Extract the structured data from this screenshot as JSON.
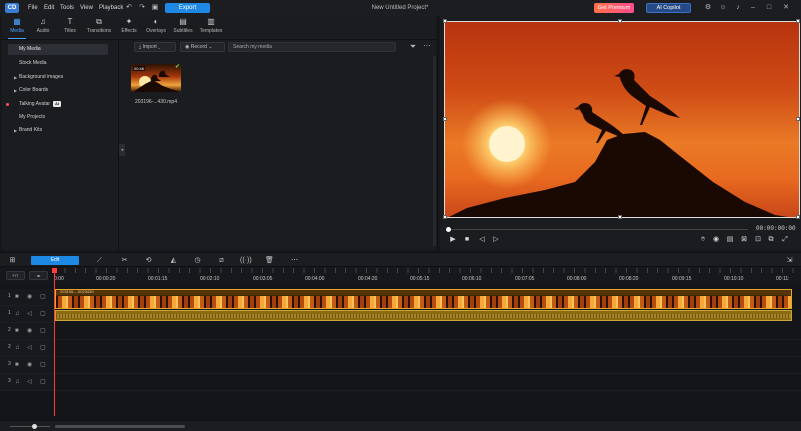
{
  "menu": {
    "app_logo": "CD",
    "items": [
      "File",
      "Edit",
      "Tools",
      "View",
      "Playback"
    ]
  },
  "header": {
    "export_label": "Export",
    "project_title": "New Untitled Project*",
    "premium_label": "Get Premium",
    "copilot_label": "AI Copilot"
  },
  "library": {
    "tabs": [
      {
        "label": "Media",
        "icon": "media-icon"
      },
      {
        "label": "Audio",
        "icon": "music-note-icon"
      },
      {
        "label": "Titles",
        "icon": "title-icon"
      },
      {
        "label": "Transitions",
        "icon": "transitions-icon"
      },
      {
        "label": "Effects",
        "icon": "effects-icon"
      },
      {
        "label": "Overlays",
        "icon": "overlays-icon"
      },
      {
        "label": "Subtitles",
        "icon": "subtitles-icon"
      },
      {
        "label": "Templates",
        "icon": "templates-icon"
      }
    ],
    "sidebar": [
      {
        "label": "My Media"
      },
      {
        "label": "Stock Media"
      },
      {
        "label": "Background images"
      },
      {
        "label": "Color Boards"
      },
      {
        "label": "Talking Avatar"
      },
      {
        "label": "My Projects"
      },
      {
        "label": "Brand Kits"
      }
    ],
    "ai_badge": "AI",
    "import_label": "Import",
    "record_label": "Record",
    "search_placeholder": "Search my media",
    "media_item": {
      "duration": "00:46",
      "name": "203196-...430.mp4"
    }
  },
  "preview": {
    "timecode": "00:00:00:00"
  },
  "timeline": {
    "edit_label": "Edit",
    "zoom_labels": [
      "FIT",
      "◂▸"
    ],
    "ruler": [
      "0:00",
      "00:00:20",
      "00:01:15",
      "00:02:10",
      "00:03:05",
      "00:04:00",
      "00:04:20",
      "00:05:15",
      "00:06:10",
      "00:07:05",
      "00:08:00",
      "00:08:20",
      "00:09:15",
      "00:10:10",
      "00:11:"
    ],
    "tracks": [
      {
        "num": "1",
        "type": "video"
      },
      {
        "num": "1",
        "type": "audio"
      },
      {
        "num": "2",
        "type": "video"
      },
      {
        "num": "2",
        "type": "audio"
      },
      {
        "num": "3",
        "type": "video"
      },
      {
        "num": "3",
        "type": "audio"
      }
    ],
    "clip_name": "203196-...0023430"
  },
  "colors": {
    "accent": "#1e88e5",
    "playhead": "#ff3b3b",
    "clip_border": "#e3a72a"
  }
}
